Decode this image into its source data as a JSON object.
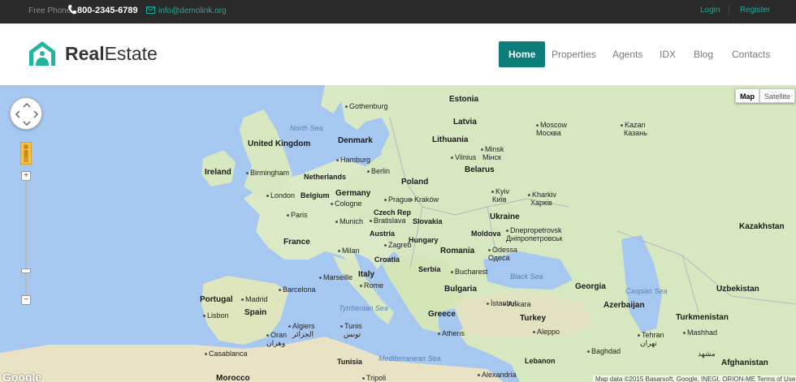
{
  "topbar": {
    "phone_label": "Free Phone:",
    "phone_number": "800-2345-6789",
    "email": "info@demolink.org",
    "login": "Login",
    "register": "Register"
  },
  "header": {
    "logo_bold": "Real",
    "logo_light": "Estate",
    "nav": [
      {
        "label": "Home",
        "active": true
      },
      {
        "label": "Properties",
        "active": false
      },
      {
        "label": "Agents",
        "active": false
      },
      {
        "label": "IDX",
        "active": false
      },
      {
        "label": "Blog",
        "active": false
      },
      {
        "label": "Contacts",
        "active": false
      }
    ]
  },
  "map": {
    "map_type": {
      "map": "Map",
      "satellite": "Satellite"
    },
    "zoom_in": "+",
    "zoom_out": "−",
    "google_label": "Google",
    "attribution": "Map data ©2015 Basarsoft, Google, INEGI, ORION-ME   Terms of Use",
    "labels": {
      "estonia": "Estonia",
      "gothenburg": "Gothenburg",
      "latvia": "Latvia",
      "moscow": "Moscow",
      "moscow_ru": "Москва",
      "kazan": "Kazan",
      "kazan_ru": "Казань",
      "north_sea": "North Sea",
      "denmark": "Denmark",
      "lithuania": "Lithuania",
      "minsk": "Minsk",
      "minsk_ru": "Мінск",
      "vilnius": "Vilnius",
      "united_kingdom": "United Kingdom",
      "hamburg": "Hamburg",
      "berlin": "Berlin",
      "belarus": "Belarus",
      "ireland": "Ireland",
      "birmingham": "Birmingham",
      "netherlands": "Netherlands",
      "poland": "Poland",
      "kyiv": "Kyiv",
      "kyiv_ua": "Київ",
      "kharkiv": "Kharkiv",
      "kharkiv_ua": "Харків",
      "london": "London",
      "belgium": "Belgium",
      "germany": "Germany",
      "prague": "Prague",
      "krakow": "Kraków",
      "cologne": "Cologne",
      "czech_rep": "Czech Rep",
      "paris": "Paris",
      "munich": "Munich",
      "bratislava": "Bratislava",
      "slovakia": "Slovakia",
      "ukraine": "Ukraine",
      "dnipro": "Dnepropetrovsk",
      "dnipro_ua": "Днiпропетровськ",
      "kazakhstan": "Kazakhstan",
      "moldova": "Moldova",
      "austria": "Austria",
      "hungary": "Hungary",
      "france": "France",
      "milan": "Milan",
      "zagreb": "Zagreb",
      "romania": "Romania",
      "odessa": "Odessa",
      "odessa_ru": "Одеса",
      "croatia": "Croatia",
      "serbia": "Serbia",
      "bucharest": "Bucharest",
      "marseille": "Marseille",
      "italy": "Italy",
      "black_sea": "Black Sea",
      "rome": "Rome",
      "bulgaria": "Bulgaria",
      "georgia": "Georgia",
      "uzbekistan": "Uzbekistan",
      "portugal": "Portugal",
      "madrid": "Madrid",
      "barcelona": "Barcelona",
      "caspian_sea": "Caspian Sea",
      "tyrrhenian_sea": "Tyrrhenian Sea",
      "istanbul": "İstanbul",
      "azerbaijan": "Azerbaijan",
      "lisbon": "Lisbon",
      "spain": "Spain",
      "greece": "Greece",
      "ankara": "Ankara",
      "turkmenistan": "Turkmenistan",
      "turkey": "Turkey",
      "algiers": "Algiers",
      "algiers_ar": "الجزائر",
      "tunis": "Tunis",
      "tunis_ar": "تونس",
      "oran": "Oran",
      "oran_ar": "وهران",
      "athens": "Athens",
      "aleppo": "Aleppo",
      "tehran": "Tehran",
      "tehran_fa": "تهران",
      "mashhad": "Mashhad",
      "mashhad_fa": "مشهد",
      "casablanca": "Casablanca",
      "mediterranean_sea": "Mediterranean Sea",
      "tunisia": "Tunisia",
      "lebanon": "Lebanon",
      "baghdad": "Baghdad",
      "afghanistan": "Afghanistan",
      "morocco": "Morocco",
      "tripoli": "Tripoli",
      "alexandria": "Alexandria"
    }
  }
}
